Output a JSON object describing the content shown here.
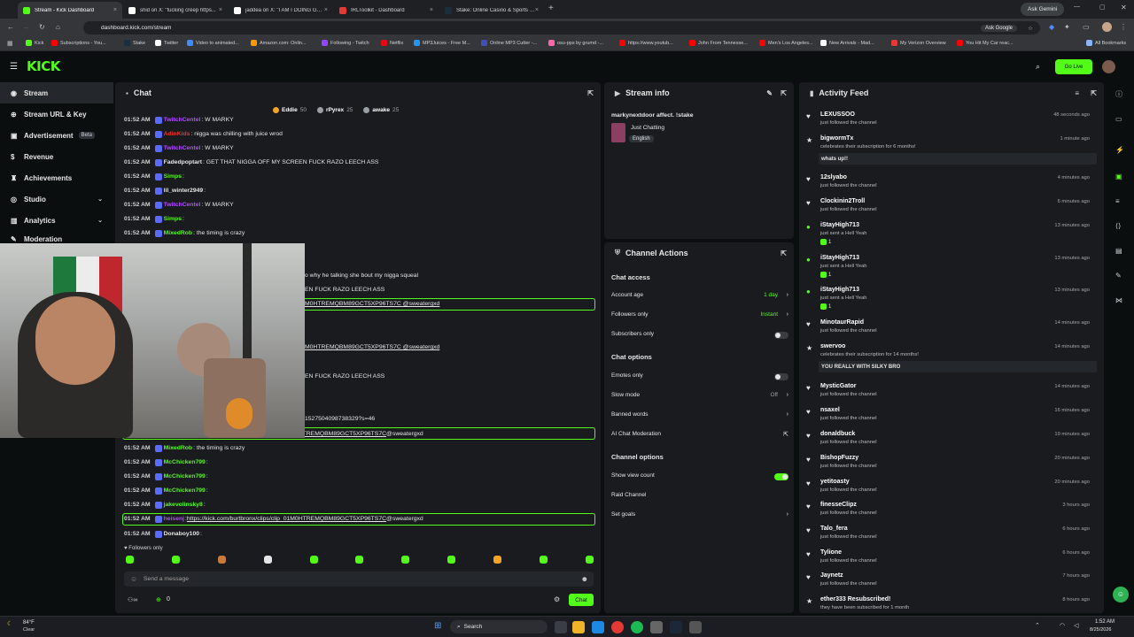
{
  "tabs": [
    {
      "label": "Stream - Kick Dashboard",
      "color": "#53fc18",
      "active": true
    },
    {
      "label": "shid on X: \"fucking creep https...",
      "color": "#ffffff"
    },
    {
      "label": "jaddea on X: \"I AM I DOING GC...",
      "color": "#ffffff"
    },
    {
      "label": "IRLToolkit - Dashboard",
      "color": "#e53935"
    },
    {
      "label": "Stake: Online Casino & Sports B...",
      "color": "#1c2e3d"
    }
  ],
  "browser": {
    "url": "dashboard.kick.com/stream",
    "ask_google": "Ask Google",
    "ask_gemini": "Ask Gemini",
    "all_bookmarks": "All Bookmarks"
  },
  "bookmarks": [
    {
      "label": "Kick",
      "color": "#53fc18"
    },
    {
      "label": "Subscriptions - You...",
      "color": "#ff0000"
    },
    {
      "label": "Stake",
      "color": "#1c2e3d"
    },
    {
      "label": "Twitter",
      "color": "#ffffff"
    },
    {
      "label": "Video to animated...",
      "color": "#3d8bff"
    },
    {
      "label": "Amazon.com: Onlin...",
      "color": "#ff9900"
    },
    {
      "label": "Following - Twitch",
      "color": "#9146ff"
    },
    {
      "label": "Netflix",
      "color": "#e50914"
    },
    {
      "label": "MP3Juices - Free M...",
      "color": "#2196f3"
    },
    {
      "label": "Online MP3 Cutter -...",
      "color": "#3f51b5"
    },
    {
      "label": "osu-pps by grumd -...",
      "color": "#ff66aa"
    },
    {
      "label": "https://www.youtub...",
      "color": "#ff0000"
    },
    {
      "label": "John From Tennesse...",
      "color": "#ff0000"
    },
    {
      "label": "Men's Los Angeles...",
      "color": "#ff0000"
    },
    {
      "label": "New Arrivals - Mad...",
      "color": "#ffffff"
    },
    {
      "label": "My Verizon Overview",
      "color": "#e53935"
    },
    {
      "label": "You Hit My Car reac...",
      "color": "#ff0000"
    }
  ],
  "header": {
    "logo": "KICK",
    "go_live": "Go Live"
  },
  "sidebar": {
    "items": [
      {
        "label": "Stream",
        "icon": "broadcast-icon",
        "active": true
      },
      {
        "label": "Stream URL & Key",
        "icon": "globe-icon"
      },
      {
        "label": "Advertisement",
        "icon": "ad-icon",
        "badge": "Beta"
      },
      {
        "label": "Revenue",
        "icon": "dollar-icon"
      },
      {
        "label": "Achievements",
        "icon": "trophy-icon"
      },
      {
        "label": "Studio",
        "icon": "studio-icon",
        "chevron": true
      },
      {
        "label": "Analytics",
        "icon": "chart-icon",
        "chevron": true
      },
      {
        "label": "Moderation",
        "icon": "wrench-icon"
      }
    ]
  },
  "chat": {
    "title": "Chat",
    "pinned": [
      {
        "name": "Eddie",
        "count": "50"
      },
      {
        "name": "rPyrex",
        "count": "25"
      },
      {
        "name": "awake",
        "count": "25"
      }
    ],
    "messages": [
      {
        "time": "01:52 AM",
        "user": "TwitchCentel",
        "color": "#b44cff",
        "text": ": W MARKY"
      },
      {
        "time": "01:52 AM",
        "user": "AdinKids",
        "color": "#e53935",
        "text": ": nigga was chilling with juice wrod"
      },
      {
        "time": "01:52 AM",
        "user": "TwitchCentel",
        "color": "#b44cff",
        "text": ": W MARKY"
      },
      {
        "time": "01:52 AM",
        "user": "Fadedpoptart",
        "color": "#e6e6e6",
        "text": ": GET THAT NIGGA OFF MY SCREEN FUCK RAZO LEECH ASS"
      },
      {
        "time": "01:52 AM",
        "user": "Simps",
        "color": "#53fc18",
        "text": ":"
      },
      {
        "time": "01:52 AM",
        "user": "lil_winter2949",
        "color": "#e6e6e6",
        "text": ":"
      },
      {
        "time": "01:52 AM",
        "user": "TwitchCentel",
        "color": "#b44cff",
        "text": ": W MARKY"
      },
      {
        "time": "01:52 AM",
        "user": "Simps",
        "color": "#53fc18",
        "text": ":"
      },
      {
        "time": "01:52 AM",
        "user": "MixedRob",
        "color": "#53fc18",
        "text": ": the timing is crazy"
      }
    ],
    "partial": [
      "o why he talking she bout my nigga squeal",
      "EN FUCK RAZO LEECH ASS",
      "M0HTREMQBM89GCT5XP96TS7C @sweatergxd",
      "M0HTREMQBM89GCT5XP96TS7C @sweatergxd",
      "EN FUCK RAZO LEECH ASS",
      "1527504098738329?s=46"
    ],
    "messages2": [
      {
        "time": "01:52 AM",
        "user": "heisenj",
        "color": "#b44cff",
        "link": "https://kick.com/burtbronx/clips/clip_01M0HTREMQBM89GCT5XP96TS7C",
        "mention": " @sweatergxd"
      },
      {
        "time": "01:52 AM",
        "user": "MixedRob",
        "color": "#53fc18",
        "text": ": the timing is crazy"
      },
      {
        "time": "01:52 AM",
        "user": "McChicken799",
        "color": "#53fc18",
        "text": ":"
      },
      {
        "time": "01:52 AM",
        "user": "McChicken799",
        "color": "#53fc18",
        "text": ":"
      },
      {
        "time": "01:52 AM",
        "user": "McChicken799",
        "color": "#53fc18",
        "text": ":"
      },
      {
        "time": "01:52 AM",
        "user": "jakevolinsky8",
        "color": "#53fc18",
        "text": ":"
      },
      {
        "time": "01:52 AM",
        "user": "heisenj",
        "color": "#b44cff",
        "link": "https://kick.com/burtbronx/clips/clip_01M0HTREMQBM89GCT5XP96TS7C",
        "mention": " @sweatergxd"
      },
      {
        "time": "01:52 AM",
        "user": "Donaboy100",
        "color": "#e6e6e6",
        "text": ":"
      }
    ],
    "followers_only": "Followers only",
    "placeholder": "Send a message",
    "count": "0",
    "send_label": "Chat"
  },
  "stream_info": {
    "title": "Stream info",
    "stream_title": "markynextdoor affect. !stake",
    "category": "Just Chatting",
    "language": "English"
  },
  "channel_actions": {
    "title": "Channel Actions",
    "chat_access": "Chat access",
    "account_age": {
      "label": "Account age",
      "value": "1 day"
    },
    "followers_only": {
      "label": "Followers only",
      "value": "Instant"
    },
    "subscribers_only": "Subscribers only",
    "chat_options": "Chat options",
    "emotes_only": "Emotes only",
    "slow_mode": {
      "label": "Slow mode",
      "value": "Off"
    },
    "banned_words": "Banned words",
    "ai_moderation": "AI Chat Moderation",
    "channel_options": "Channel options",
    "show_view_count": "Show view count",
    "raid_channel": "Raid Channel",
    "set_goals": "Set goals"
  },
  "activity": {
    "title": "Activity Feed",
    "items": [
      {
        "name": "LEXUSSOO",
        "sub": "just followed the channel",
        "time": "48 seconds ago"
      },
      {
        "name": "bigwormTx",
        "sub": "celebrates their subscription for 6 months!",
        "time": "1 minute ago",
        "quote": "whats up!!"
      },
      {
        "name": "12slyabo",
        "sub": "just followed the channel",
        "time": "4 minutes ago"
      },
      {
        "name": "Clockinin2Troll",
        "sub": "just followed the channel",
        "time": "6 minutes ago"
      },
      {
        "name": "iStayHigh713",
        "sub": "just sent a Hell Yeah",
        "time": "13 minutes ago",
        "count": "1"
      },
      {
        "name": "iStayHigh713",
        "sub": "just sent a Hell Yeah",
        "time": "13 minutes ago",
        "count": "1"
      },
      {
        "name": "iStayHigh713",
        "sub": "just sent a Hell Yeah",
        "time": "13 minutes ago",
        "count": "1"
      },
      {
        "name": "MinotaurRapid",
        "sub": "just followed the channel",
        "time": "14 minutes ago"
      },
      {
        "name": "swervoo",
        "sub": "celebrates their subscription for 14 months!",
        "time": "14 minutes ago",
        "quote": "YOU REALLY WITH SILKY BRO"
      },
      {
        "name": "MysticGator",
        "sub": "just followed the channel",
        "time": "14 minutes ago"
      },
      {
        "name": "nsaxel",
        "sub": "just followed the channel",
        "time": "16 minutes ago"
      },
      {
        "name": "donaldbuck",
        "sub": "just followed the channel",
        "time": "19 minutes ago"
      },
      {
        "name": "BishopFuzzy",
        "sub": "just followed the channel",
        "time": "20 minutes ago"
      },
      {
        "name": "yetitoasty",
        "sub": "just followed the channel",
        "time": "20 minutes ago"
      },
      {
        "name": "finesseClipz",
        "sub": "just followed the channel",
        "time": "3 hours ago"
      },
      {
        "name": "Talo_fera",
        "sub": "just followed the channel",
        "time": "6 hours ago"
      },
      {
        "name": "Tylione",
        "sub": "just followed the channel",
        "time": "6 hours ago"
      },
      {
        "name": "Jaynetz",
        "sub": "just followed the channel",
        "time": "7 hours ago"
      },
      {
        "name": "ether333 Resubscribed!",
        "sub": "they have been subscribed for 1 month",
        "time": "8 hours ago"
      }
    ]
  },
  "taskbar": {
    "weather_temp": "84°F",
    "weather_desc": "Clear",
    "search": "Search",
    "time": "1:52 AM",
    "date": "8/25/2026"
  }
}
